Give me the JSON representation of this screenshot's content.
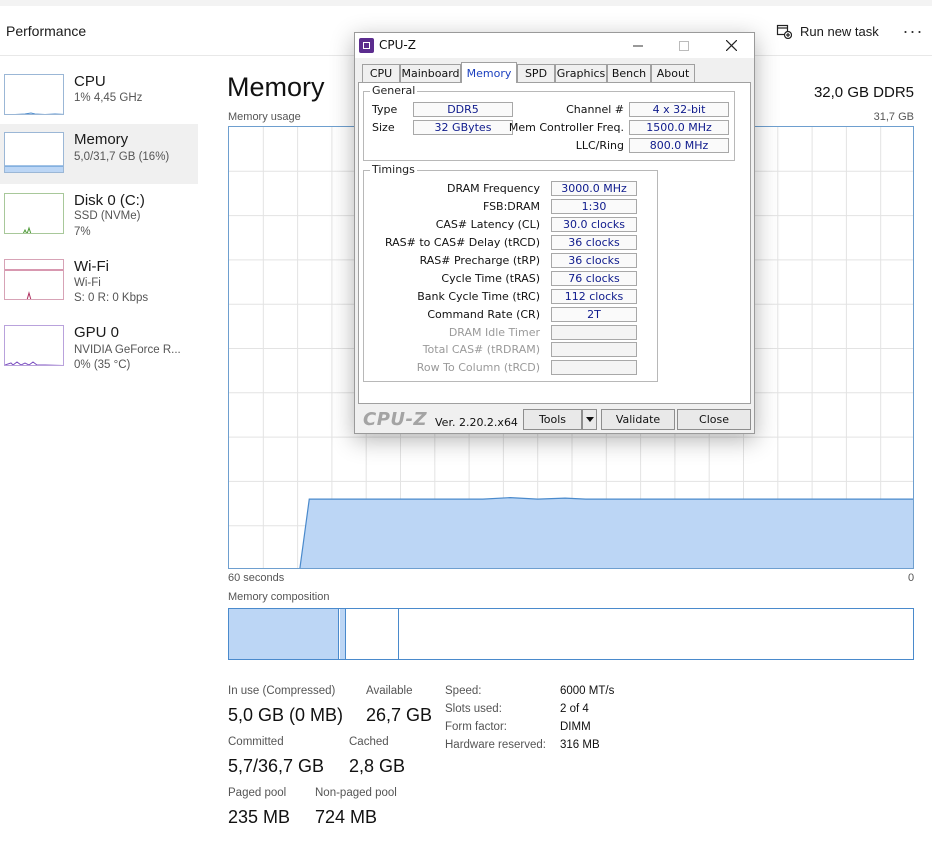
{
  "header": {
    "title": "Performance",
    "run_new_task": "Run new task",
    "more": "···"
  },
  "sidebar": {
    "items": [
      {
        "name": "CPU",
        "sub1": "1% 4,45 GHz",
        "sub2": ""
      },
      {
        "name": "Memory",
        "sub1": "5,0/31,7 GB (16%)",
        "sub2": ""
      },
      {
        "name": "Disk 0 (C:)",
        "sub1": "SSD (NVMe)",
        "sub2": "7%"
      },
      {
        "name": "Wi-Fi",
        "sub1": "Wi-Fi",
        "sub2": "S: 0 R: 0 Kbps"
      },
      {
        "name": "GPU 0",
        "sub1": "NVIDIA GeForce R...",
        "sub2": "0% (35 °C)"
      }
    ]
  },
  "main": {
    "title": "Memory",
    "spec": "32,0 GB DDR5",
    "usage_label": "Memory usage",
    "usage_max": "31,7 GB",
    "x_left": "60 seconds",
    "x_right": "0",
    "composition_label": "Memory composition",
    "usage_level": 0.16,
    "stats": {
      "in_use_label": "In use (Compressed)",
      "in_use_value": "5,0 GB (0 MB)",
      "available_label": "Available",
      "available_value": "26,7 GB",
      "committed_label": "Committed",
      "committed_value": "5,7/36,7 GB",
      "cached_label": "Cached",
      "cached_value": "2,8 GB",
      "paged_label": "Paged pool",
      "paged_value": "235 MB",
      "nonpaged_label": "Non-paged pool",
      "nonpaged_value": "724 MB"
    },
    "details": [
      {
        "label": "Speed:",
        "value": "6000 MT/s"
      },
      {
        "label": "Slots used:",
        "value": "2 of 4"
      },
      {
        "label": "Form factor:",
        "value": "DIMM"
      },
      {
        "label": "Hardware reserved:",
        "value": "316 MB"
      }
    ]
  },
  "cpuz": {
    "title": "CPU-Z",
    "tabs": [
      "CPU",
      "Mainboard",
      "Memory",
      "SPD",
      "Graphics",
      "Bench",
      "About"
    ],
    "active_tab": "Memory",
    "general": {
      "title": "General",
      "type_label": "Type",
      "type_value": "DDR5",
      "size_label": "Size",
      "size_value": "32 GBytes",
      "channel_label": "Channel #",
      "channel_value": "4 x 32-bit",
      "mcf_label": "Mem Controller Freq.",
      "mcf_value": "1500.0 MHz",
      "llc_label": "LLC/Ring",
      "llc_value": "800.0 MHz"
    },
    "timings": {
      "title": "Timings",
      "rows": [
        {
          "label": "DRAM Frequency",
          "value": "3000.0 MHz"
        },
        {
          "label": "FSB:DRAM",
          "value": "1:30"
        },
        {
          "label": "CAS# Latency (CL)",
          "value": "30.0 clocks"
        },
        {
          "label": "RAS# to CAS# Delay (tRCD)",
          "value": "36 clocks"
        },
        {
          "label": "RAS# Precharge (tRP)",
          "value": "36 clocks"
        },
        {
          "label": "Cycle Time (tRAS)",
          "value": "76 clocks"
        },
        {
          "label": "Bank Cycle Time (tRC)",
          "value": "112 clocks"
        },
        {
          "label": "Command Rate (CR)",
          "value": "2T"
        },
        {
          "label": "DRAM Idle Timer",
          "value": ""
        },
        {
          "label": "Total CAS# (tRDRAM)",
          "value": ""
        },
        {
          "label": "Row To Column (tRCD)",
          "value": ""
        }
      ]
    },
    "footer": {
      "brand": "CPU-Z",
      "version": "Ver. 2.20.2.x64",
      "tools": "Tools",
      "validate": "Validate",
      "close": "Close"
    }
  },
  "colors": {
    "graph_line": "#4a8acc",
    "graph_fill": "#bcd6f5",
    "cpuz_value": "#0e1a8c",
    "wifi_line": "#b03060",
    "disk_line": "#4e9a38",
    "gpu_line": "#7b4fc0"
  }
}
